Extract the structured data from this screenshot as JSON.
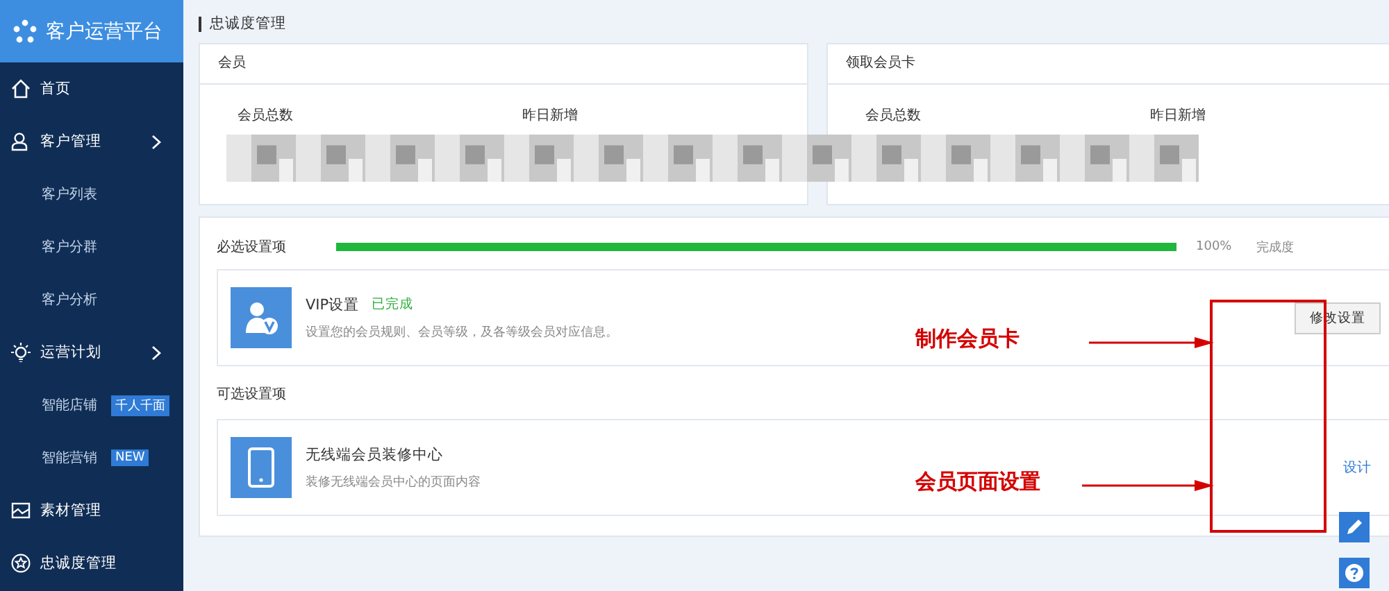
{
  "sidebar": {
    "logo": "客户运营平台",
    "items": [
      {
        "label": "首页",
        "kind": "main"
      },
      {
        "label": "客户管理",
        "kind": "main",
        "expanded": true
      },
      {
        "label": "客户列表",
        "kind": "sub"
      },
      {
        "label": "客户分群",
        "kind": "sub"
      },
      {
        "label": "客户分析",
        "kind": "sub"
      },
      {
        "label": "运营计划",
        "kind": "main",
        "expanded": true
      },
      {
        "label": "智能店铺",
        "kind": "sub",
        "badge": "千人千面"
      },
      {
        "label": "智能营销",
        "kind": "sub",
        "badge": "NEW"
      },
      {
        "label": "素材管理",
        "kind": "main"
      },
      {
        "label": "忠诚度管理",
        "kind": "main"
      }
    ]
  },
  "page_title": "忠诚度管理",
  "cards": [
    {
      "title": "会员",
      "stats": [
        "会员总数",
        "昨日新增"
      ]
    },
    {
      "title": "领取会员卡",
      "stats": [
        "会员总数",
        "昨日新增"
      ]
    }
  ],
  "required": {
    "label": "必选设置项",
    "level": 1,
    "percent": "100%",
    "caption": "完成度",
    "items": [
      {
        "title": "VIP设置",
        "status": "已完成",
        "desc": "设置您的会员规则、会员等级，及各等级会员对应信息。",
        "button": "修改设置"
      }
    ]
  },
  "optional": {
    "label": "可选设置项",
    "items": [
      {
        "title": "无线端会员装修中心",
        "desc": "装修无线端会员中心的页面内容",
        "button": "设计"
      }
    ]
  },
  "annotations": [
    "制作会员卡",
    "会员页面设置"
  ]
}
